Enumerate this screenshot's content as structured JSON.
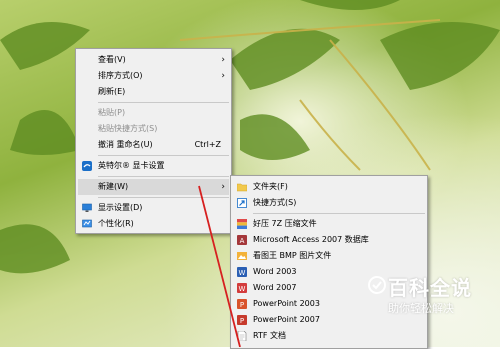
{
  "context_menu": {
    "items": [
      {
        "label": "查看(V)"
      },
      {
        "label": "排序方式(O)"
      },
      {
        "label": "刷新(E)"
      },
      {
        "label": "粘贴(P)"
      },
      {
        "label": "粘贴快捷方式(S)"
      },
      {
        "label": "撤消 重命名(U)",
        "shortcut": "Ctrl+Z"
      },
      {
        "label": "英特尔® 显卡设置"
      },
      {
        "label": "新建(W)"
      },
      {
        "label": "显示设置(D)"
      },
      {
        "label": "个性化(R)"
      }
    ]
  },
  "new_submenu": {
    "items": [
      {
        "label": "文件夹(F)"
      },
      {
        "label": "快捷方式(S)"
      },
      {
        "label": "好压 7Z 压缩文件"
      },
      {
        "label": "Microsoft Access 2007 数据库"
      },
      {
        "label": "看图王 BMP 图片文件"
      },
      {
        "label": "Word 2003"
      },
      {
        "label": "Word 2007"
      },
      {
        "label": "PowerPoint 2003"
      },
      {
        "label": "PowerPoint 2007"
      },
      {
        "label": "RTF 文档"
      }
    ]
  },
  "watermark": {
    "title": "百科全说",
    "subtitle": "助你轻松解决"
  },
  "colors": {
    "accent_red": "#d62020",
    "menu_bg": "#f0f0f0"
  }
}
